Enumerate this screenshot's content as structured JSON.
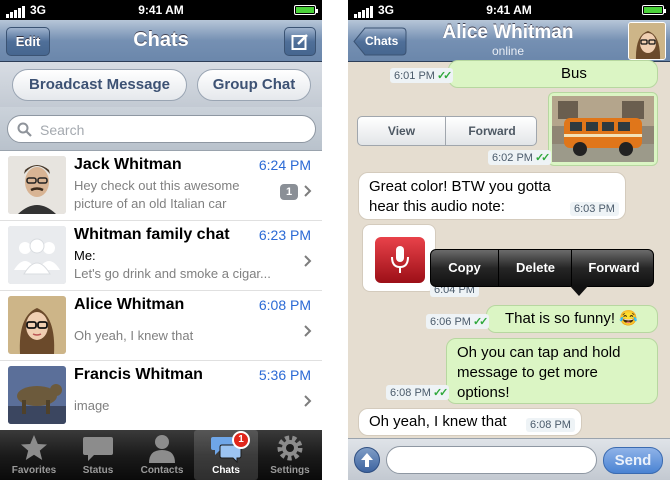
{
  "status_bar": {
    "carrier": "3G",
    "time": "9:41 AM"
  },
  "chats_screen": {
    "nav": {
      "title": "Chats",
      "edit_label": "Edit",
      "compose_icon": "compose-icon"
    },
    "broadcast_label": "Broadcast Message",
    "group_chat_label": "Group Chat",
    "search": {
      "placeholder": "Search"
    },
    "chats": [
      {
        "name": "Jack Whitman",
        "time": "6:24 PM",
        "line1": "Hey check out this awesome",
        "line2": "picture of an old Italian car",
        "badge": "1"
      },
      {
        "name": "Whitman family chat",
        "time": "6:23 PM",
        "sender": "Me:",
        "line2": "Let's go drink and smoke a cigar..."
      },
      {
        "name": "Alice Whitman",
        "time": "6:08 PM",
        "line1": "Oh yeah, I knew that"
      },
      {
        "name": "Francis Whitman",
        "time": "5:36 PM",
        "line1": "image"
      }
    ],
    "tabs": [
      {
        "label": "Favorites",
        "icon": "star-icon"
      },
      {
        "label": "Status",
        "icon": "speech-bubble-icon"
      },
      {
        "label": "Contacts",
        "icon": "person-icon"
      },
      {
        "label": "Chats",
        "icon": "chats-icon",
        "badge": "1",
        "active": true
      },
      {
        "label": "Settings",
        "icon": "gear-icon"
      }
    ]
  },
  "conversation_screen": {
    "nav": {
      "back_label": "Chats",
      "title": "Alice Whitman",
      "subtitle": "online"
    },
    "messages": {
      "m1": {
        "text": "Bus",
        "time": "6:01 PM",
        "direction": "out"
      },
      "m2": {
        "type": "image",
        "time": "6:02 PM",
        "direction": "out"
      },
      "m3": {
        "text": "Great color! BTW you gotta hear this audio note:",
        "time": "6:03 PM",
        "direction": "in"
      },
      "m4": {
        "type": "audio",
        "time": "6:04 PM",
        "direction": "in"
      },
      "m5": {
        "text": "That is so funny! 😂",
        "time": "6:06 PM",
        "direction": "out"
      },
      "m6": {
        "text": "Oh you can tap and hold message to get more options!",
        "time": "6:08 PM",
        "direction": "out"
      },
      "m7": {
        "text": "Oh yeah, I knew that",
        "time": "6:08 PM",
        "direction": "in"
      }
    },
    "image_actions": {
      "view_label": "View",
      "forward_label": "Forward"
    },
    "context_menu": {
      "copy_label": "Copy",
      "delete_label": "Delete",
      "forward_label": "Forward"
    },
    "send_label": "Send"
  },
  "colors": {
    "accent_blue": "#2b6ad5",
    "bubble_out": "#dbf5c4",
    "bubble_in": "#ffffff",
    "badge_red": "#e0261b",
    "chat_background": "#e5ddd0"
  }
}
